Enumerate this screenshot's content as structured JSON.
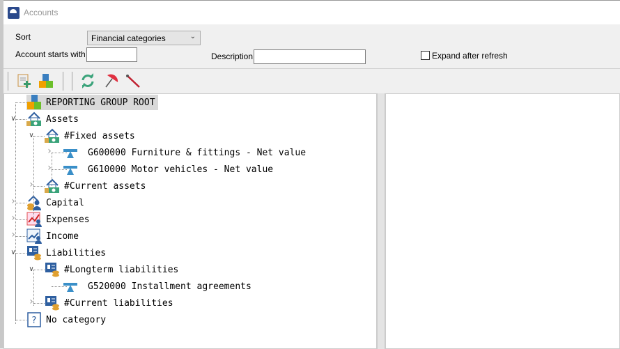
{
  "window": {
    "title": "Accounts"
  },
  "filters": {
    "sort_label": "Sort",
    "sort_value": "Financial categories",
    "account_label": "Account starts with",
    "account_value": "",
    "description_label": "Description",
    "description_value": "",
    "expand_label": "Expand after refresh",
    "expand_checked": false
  },
  "toolbar": {
    "buttons": [
      "add-account",
      "reporting-groups",
      "refresh",
      "umbrella",
      "pin"
    ]
  },
  "tree": {
    "nodes": [
      {
        "label": "REPORTING GROUP ROOT",
        "icon": "blocks-icon"
      },
      {
        "label": "Assets",
        "icon": "house-money-icon"
      },
      {
        "label": "#Fixed assets",
        "icon": "house-money-icon"
      },
      {
        "label": "G600000 Furniture & fittings - Net value",
        "icon": "seesaw-icon"
      },
      {
        "label": "G610000 Motor vehicles - Net value",
        "icon": "seesaw-icon"
      },
      {
        "label": "#Current assets",
        "icon": "house-money-icon"
      },
      {
        "label": "Capital",
        "icon": "coins-person-icon"
      },
      {
        "label": "Expenses",
        "icon": "chart-down-icon"
      },
      {
        "label": "Income",
        "icon": "chart-up-icon"
      },
      {
        "label": "Liabilities",
        "icon": "ledger-icon"
      },
      {
        "label": "#Longterm liabilities",
        "icon": "ledger-icon"
      },
      {
        "label": "G520000 Installment agreements",
        "icon": "seesaw-icon"
      },
      {
        "label": "#Current liabilities",
        "icon": "ledger-icon"
      },
      {
        "label": "No category",
        "icon": "question-icon"
      }
    ]
  }
}
